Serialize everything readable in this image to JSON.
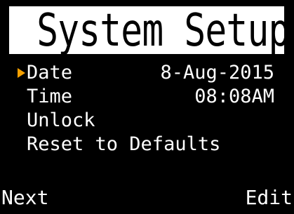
{
  "header": {
    "title": "System Setup"
  },
  "menu": {
    "selected_index": 0,
    "items": [
      {
        "label": "Date",
        "value": "8-Aug-2015"
      },
      {
        "label": "Time",
        "value": "08:08AM"
      },
      {
        "label": "Unlock",
        "value": ""
      },
      {
        "label": "Reset to Defaults",
        "value": ""
      }
    ]
  },
  "softkeys": {
    "left_label": "Next",
    "right_label": "Edit"
  },
  "icons": {
    "selection_cursor": "triangle-right-icon"
  },
  "colors": {
    "background": "#000000",
    "text": "#ffffff",
    "title_background": "#ffffff",
    "title_text": "#000000",
    "cursor": "#f5a000"
  }
}
